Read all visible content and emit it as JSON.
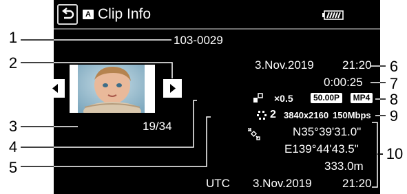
{
  "header": {
    "back_icon": "back-arrow-icon",
    "mode_badge": "A",
    "title": "Clip Info",
    "battery_icon": "battery-full-icon"
  },
  "clip": {
    "number": "103-0029",
    "date": "3.Nov.2019",
    "time": "21:20",
    "duration": "0:00:25",
    "position": "19/34",
    "slow_fast_icon": "slow-fast-motion-icon",
    "slow_fast_value": "×0.5",
    "frame_rate": "50.00P",
    "format": "MP4",
    "quality_icon": "image-quality-icon",
    "quality_value": "2",
    "resolution": "3840x2160",
    "bitrate": "150Mbps",
    "gps_icon": "gps-satellite-icon",
    "latitude": "N35°39'31.0\"",
    "longitude": "E139°44'43.5\"",
    "altitude": "333.0m",
    "utc_label": "UTC",
    "utc_date": "3.Nov.2019",
    "utc_time": "21:20"
  },
  "navigation": {
    "prev_icon": "triangle-left-icon",
    "next_icon": "triangle-right-icon"
  },
  "callouts": [
    "1",
    "2",
    "3",
    "4",
    "5",
    "6",
    "7",
    "8",
    "9",
    "10"
  ],
  "colors": {
    "screen": "#000000",
    "text": "#ffffff",
    "page": "#ffffff"
  }
}
